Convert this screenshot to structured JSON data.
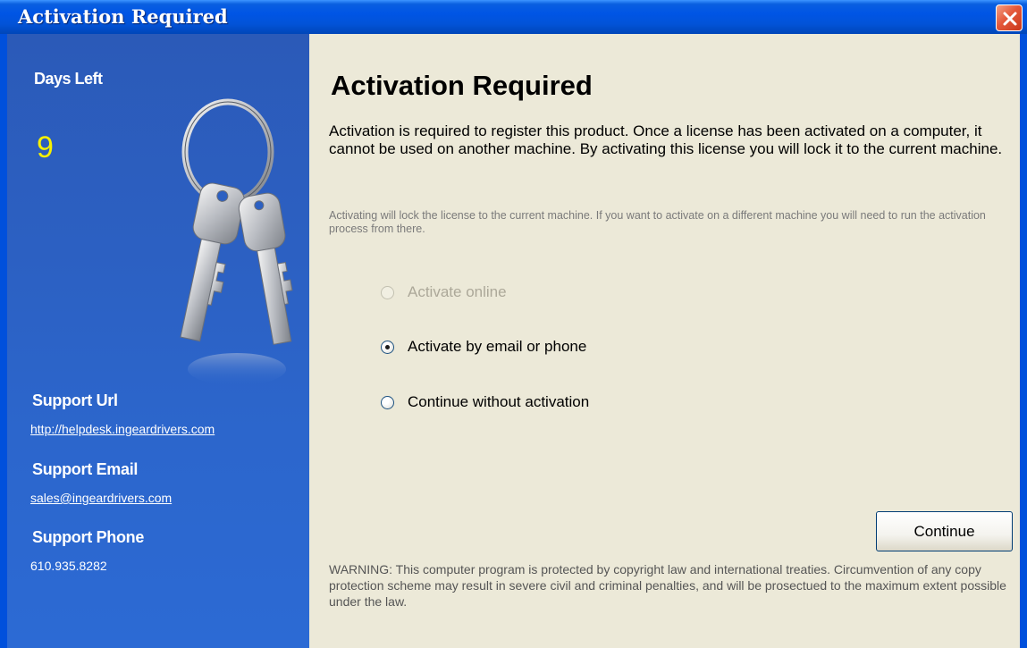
{
  "window": {
    "title": "Activation Required",
    "close_icon": "close-x-icon",
    "colors": {
      "titlebar": "#0055e5",
      "sidebar": "#2c60c2",
      "close": "#e4583a",
      "days_value": "#f6f000"
    }
  },
  "sidebar": {
    "days_left_label": "Days Left",
    "days_left_value": "9",
    "illustration": "keyring-icon",
    "support_url_label": "Support Url",
    "support_url": "http://helpdesk.ingeardrivers.com",
    "support_email_label": "Support Email",
    "support_email": "sales@ingeardrivers.com",
    "support_phone_label": "Support Phone",
    "support_phone": "610.935.8282"
  },
  "main": {
    "heading": "Activation Required",
    "intro": "Activation is required to register this product. Once a license has been activated on a computer, it cannot be used on another machine. By activating this license you will lock it to the current machine.",
    "note": "Activating will lock the license to the current machine. If you want to activate on a different machine you will need to run the activation process from there.",
    "options": [
      {
        "label": "Activate online",
        "enabled": false,
        "selected": false
      },
      {
        "label": "Activate by email or phone",
        "enabled": true,
        "selected": true
      },
      {
        "label": "Continue without activation",
        "enabled": true,
        "selected": false
      }
    ],
    "continue_label": "Continue",
    "warning": "WARNING: This computer program is protected by copyright law and international treaties. Circumvention of any copy protection scheme may result in severe civil and criminal penalties, and will be prosectued to the maximum extent possible under the law."
  }
}
